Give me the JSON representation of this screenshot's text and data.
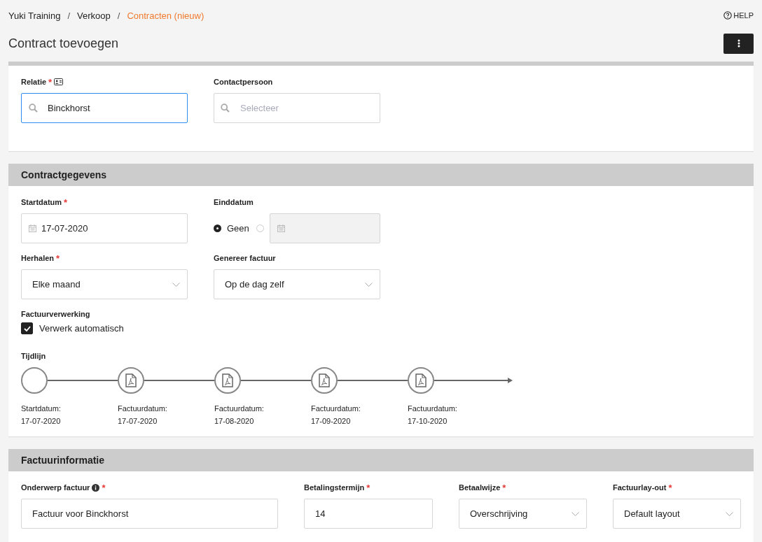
{
  "breadcrumb": [
    {
      "label": "Yuki Training",
      "current": false
    },
    {
      "separator": "/",
      "label": "Verkoop",
      "current": false
    },
    {
      "separator": "/",
      "label": "Contracten (nieuw)",
      "current": true
    }
  ],
  "help": "HELP",
  "title": "Contract toevoegen",
  "relation": {
    "label": "Relatie",
    "required_mark": "*",
    "value": "Binckhorst",
    "focused": true
  },
  "contact": {
    "label": "Contactpersoon",
    "placeholder": "Selecteer"
  },
  "contract": {
    "title": "Contractgegevens",
    "start": {
      "label": "Startdatum",
      "required_mark": "*",
      "value": "17-07-2020"
    },
    "end": {
      "label": "Einddatum",
      "options": [
        {
          "label": "Geen",
          "selected": true
        },
        {
          "selected": false
        }
      ]
    },
    "repeat": {
      "label": "Herhalen",
      "required_mark": "*",
      "value": "Elke maand"
    },
    "generate": {
      "label": "Genereer factuur",
      "value": "Op de dag zelf"
    },
    "processing": {
      "label": "Factuurverwerking",
      "checkbox": "Verwerk automatisch",
      "checked": true
    },
    "timeline": {
      "label": "Tijdlijn",
      "nodes": [
        {
          "kind": "start",
          "caption": "Startdatum:",
          "date": "17-07-2020"
        },
        {
          "kind": "invoice",
          "caption": "Factuurdatum:",
          "date": "17-07-2020"
        },
        {
          "kind": "invoice",
          "caption": "Factuurdatum:",
          "date": "17-08-2020"
        },
        {
          "kind": "invoice",
          "caption": "Factuurdatum:",
          "date": "17-09-2020"
        },
        {
          "kind": "invoice",
          "caption": "Factuurdatum:",
          "date": "17-10-2020"
        }
      ]
    }
  },
  "invoice": {
    "title": "Factuurinformatie",
    "fields": [
      {
        "kind": "text",
        "label": "Onderwerp factuur",
        "info": true,
        "required_mark": "*",
        "value": "Factuur voor  Binckhorst"
      },
      {
        "kind": "text",
        "label": "Betalingstermijn",
        "info": false,
        "required_mark": "*",
        "value": "14"
      },
      {
        "kind": "select",
        "label": "Betaalwijze",
        "info": false,
        "required_mark": "*",
        "value": "Overschrijving"
      },
      {
        "kind": "select",
        "label": "Factuurlay-out",
        "info": false,
        "required_mark": "*",
        "value": "Default layout"
      }
    ]
  }
}
